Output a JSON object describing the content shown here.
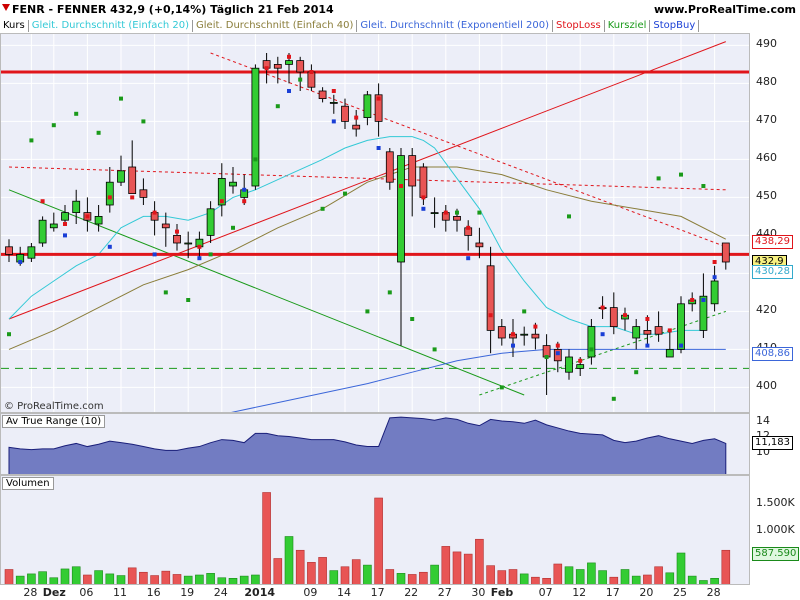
{
  "header": {
    "title": "FENR - FENNER   432,9 (+0,14%)   Täglich  21 Feb 2014",
    "site": "www.ProRealTime.com"
  },
  "legend": {
    "items": [
      {
        "label": "Kurs",
        "color": "#000000"
      },
      {
        "label": "Gleit. Durchschnitt (Einfach 20)",
        "color": "#33c9d6"
      },
      {
        "label": "Gleit. Durchschnitt (Einfach 40)",
        "color": "#8a7d3a"
      },
      {
        "label": "Gleit. Durchschnitt (Exponentiell 200)",
        "color": "#3b66d9"
      },
      {
        "label": "StopLoss",
        "color": "#e0151b"
      },
      {
        "label": "Kursziel",
        "color": "#1a9a1a"
      },
      {
        "label": "StopBuy",
        "color": "#1a3fd6"
      }
    ]
  },
  "copyright": "© ProRealTime.com",
  "atr_title": "Av True Range (10)",
  "volume_title": "Volumen",
  "colors": {
    "up": "#33cc33",
    "down": "#e85555",
    "price_pane_bg": "#eceef8",
    "atr_fill": "#4a55b0"
  },
  "chart_data": [
    {
      "type": "candlestick",
      "title": "FENR - FENNER",
      "ylim": [
        393,
        493
      ],
      "y_ticks": [
        400,
        410,
        420,
        430,
        440,
        450,
        460,
        470,
        480,
        490
      ],
      "x_tick_labels": [
        {
          "label": "28",
          "idx": 2
        },
        {
          "label": "Dez",
          "idx": 4,
          "bold": true
        },
        {
          "label": "06",
          "idx": 7
        },
        {
          "label": "11",
          "idx": 10
        },
        {
          "label": "16",
          "idx": 13
        },
        {
          "label": "19",
          "idx": 16
        },
        {
          "label": "24",
          "idx": 19
        },
        {
          "label": "2014",
          "idx": 22,
          "bold": true
        },
        {
          "label": "09",
          "idx": 27
        },
        {
          "label": "14",
          "idx": 30
        },
        {
          "label": "17",
          "idx": 33
        },
        {
          "label": "22",
          "idx": 36
        },
        {
          "label": "27",
          "idx": 39
        },
        {
          "label": "30",
          "idx": 42
        },
        {
          "label": "Feb",
          "idx": 44,
          "bold": true
        },
        {
          "label": "07",
          "idx": 48
        },
        {
          "label": "12",
          "idx": 51
        },
        {
          "label": "17",
          "idx": 54
        },
        {
          "label": "20",
          "idx": 57
        },
        {
          "label": "25",
          "idx": 60
        },
        {
          "label": "28",
          "idx": 63
        }
      ],
      "candles": [
        [
          437,
          439,
          433,
          435
        ],
        [
          433,
          437,
          432,
          435
        ],
        [
          434,
          438,
          433,
          437
        ],
        [
          438,
          445,
          437,
          444
        ],
        [
          442,
          446,
          441,
          443
        ],
        [
          444,
          448,
          443,
          446
        ],
        [
          446,
          452,
          443,
          449
        ],
        [
          446,
          450,
          441,
          444
        ],
        [
          443,
          448,
          441,
          445
        ],
        [
          448,
          458,
          446,
          454
        ],
        [
          454,
          461,
          453,
          457
        ],
        [
          458,
          465,
          453,
          451
        ],
        [
          452,
          455,
          448,
          450
        ],
        [
          446,
          449,
          440,
          444
        ],
        [
          443,
          446,
          437,
          442
        ],
        [
          440,
          443,
          436,
          438
        ],
        [
          438,
          441,
          434,
          438
        ],
        [
          437,
          441,
          434,
          439
        ],
        [
          440,
          449,
          438,
          447
        ],
        [
          448,
          459,
          445,
          455
        ],
        [
          453,
          458,
          451,
          454
        ],
        [
          450,
          456,
          448,
          452
        ],
        [
          453,
          485,
          452,
          484
        ],
        [
          486,
          488,
          480,
          484
        ],
        [
          485,
          487,
          480,
          484
        ],
        [
          485,
          488,
          480,
          486
        ],
        [
          486,
          487,
          478,
          483
        ],
        [
          483,
          485,
          478,
          479
        ],
        [
          478,
          479,
          475,
          476
        ],
        [
          475,
          477,
          472,
          475
        ],
        [
          474,
          476,
          468,
          470
        ],
        [
          469,
          473,
          466,
          468
        ],
        [
          471,
          478,
          469,
          477
        ],
        [
          477,
          480,
          466,
          470
        ],
        [
          462,
          463,
          452,
          454
        ],
        [
          433,
          463,
          411,
          461
        ],
        [
          461,
          463,
          445,
          453
        ],
        [
          458,
          459,
          448,
          450
        ],
        [
          446,
          450,
          442,
          446
        ],
        [
          446,
          448,
          441,
          444
        ],
        [
          445,
          447,
          441,
          444
        ],
        [
          442,
          444,
          436,
          440
        ],
        [
          438,
          442,
          434,
          437
        ],
        [
          432,
          437,
          409,
          415
        ],
        [
          416,
          418,
          411,
          413
        ],
        [
          414,
          418,
          408,
          413
        ],
        [
          414,
          416,
          411,
          414
        ],
        [
          414,
          417,
          410,
          413
        ],
        [
          411,
          414,
          398,
          408
        ],
        [
          410,
          412,
          404,
          407
        ],
        [
          404,
          410,
          402,
          408
        ],
        [
          405,
          408,
          403,
          406
        ],
        [
          408,
          418,
          406,
          416
        ],
        [
          421,
          424,
          418,
          421
        ],
        [
          421,
          425,
          414,
          416
        ],
        [
          418,
          421,
          415,
          419
        ],
        [
          413,
          418,
          410,
          416
        ],
        [
          415,
          419,
          411,
          414
        ],
        [
          416,
          420,
          412,
          414
        ],
        [
          408,
          415,
          408,
          410
        ],
        [
          410,
          424,
          409,
          422
        ],
        [
          422,
          425,
          420,
          423
        ],
        [
          415,
          430,
          413,
          424
        ],
        [
          422,
          432,
          420,
          428
        ],
        [
          438,
          438,
          431,
          433
        ]
      ],
      "sma20": [
        [
          0,
          418
        ],
        [
          2,
          424
        ],
        [
          4,
          428
        ],
        [
          6,
          432
        ],
        [
          8,
          435
        ],
        [
          10,
          442
        ],
        [
          12,
          445
        ],
        [
          14,
          445
        ],
        [
          16,
          444
        ],
        [
          18,
          446
        ],
        [
          20,
          450
        ],
        [
          22,
          452
        ],
        [
          25,
          456
        ],
        [
          28,
          460
        ],
        [
          30,
          463
        ],
        [
          32,
          465
        ],
        [
          34,
          466
        ],
        [
          35,
          466
        ],
        [
          36,
          466
        ],
        [
          37,
          465
        ],
        [
          38,
          463
        ],
        [
          40,
          455
        ],
        [
          42,
          447
        ],
        [
          44,
          436
        ],
        [
          46,
          428
        ],
        [
          48,
          421
        ],
        [
          50,
          418
        ],
        [
          52,
          416
        ],
        [
          54,
          416
        ],
        [
          56,
          414
        ],
        [
          58,
          414
        ],
        [
          60,
          415
        ],
        [
          62,
          415
        ]
      ],
      "sma40": [
        [
          0,
          410
        ],
        [
          4,
          415
        ],
        [
          8,
          421
        ],
        [
          12,
          427
        ],
        [
          16,
          431
        ],
        [
          20,
          436
        ],
        [
          24,
          442
        ],
        [
          28,
          447
        ],
        [
          32,
          454
        ],
        [
          36,
          458
        ],
        [
          40,
          458
        ],
        [
          44,
          456
        ],
        [
          48,
          452
        ],
        [
          52,
          449
        ],
        [
          56,
          447
        ],
        [
          60,
          445
        ],
        [
          64,
          439
        ]
      ],
      "ema200": [
        [
          0,
          384
        ],
        [
          8,
          386
        ],
        [
          16,
          391
        ],
        [
          24,
          396
        ],
        [
          32,
          401
        ],
        [
          36,
          404
        ],
        [
          40,
          407
        ],
        [
          44,
          409
        ],
        [
          48,
          410
        ],
        [
          52,
          410
        ],
        [
          56,
          410
        ],
        [
          60,
          410
        ],
        [
          64,
          410
        ]
      ],
      "hlines": [
        {
          "y": 483,
          "color": "#e0151b"
        },
        {
          "y": 435,
          "color": "#e0151b"
        },
        {
          "y": 405,
          "color": "#1a9a1a",
          "dashed": true
        }
      ],
      "trend_lines": [
        {
          "x1": 0,
          "y1": 418,
          "x2": 64,
          "y2": 491,
          "color": "#e0151b",
          "dashed": false
        },
        {
          "x1": 0,
          "y1": 458,
          "x2": 64,
          "y2": 452,
          "color": "#e0151b",
          "dashed": true
        },
        {
          "x1": 18,
          "y1": 488,
          "x2": 64,
          "y2": 437,
          "color": "#e0151b",
          "dashed": true
        },
        {
          "x1": 0,
          "y1": 452,
          "x2": 46,
          "y2": 398,
          "color": "#1a9a1a",
          "dashed": false
        },
        {
          "x1": 42,
          "y1": 398,
          "x2": 64,
          "y2": 420,
          "color": "#1a9a1a",
          "dashed": true
        }
      ],
      "stoploss_dots": [
        [
          3,
          449
        ],
        [
          5,
          443
        ],
        [
          7,
          445
        ],
        [
          9,
          450
        ],
        [
          11,
          450
        ],
        [
          13,
          446
        ],
        [
          15,
          441
        ],
        [
          17,
          437
        ],
        [
          19,
          449
        ],
        [
          21,
          449
        ],
        [
          23,
          484
        ],
        [
          25,
          487
        ],
        [
          27,
          483
        ],
        [
          29,
          478
        ],
        [
          31,
          471
        ],
        [
          33,
          476
        ],
        [
          35,
          453
        ],
        [
          37,
          450
        ],
        [
          39,
          446
        ],
        [
          41,
          442
        ],
        [
          43,
          419
        ],
        [
          45,
          414
        ],
        [
          47,
          416
        ],
        [
          49,
          411
        ],
        [
          51,
          407
        ],
        [
          53,
          421
        ],
        [
          55,
          419
        ],
        [
          57,
          418
        ],
        [
          59,
          415
        ],
        [
          61,
          423
        ],
        [
          63,
          433
        ]
      ],
      "kursziel_dots": [
        [
          0,
          414
        ],
        [
          2,
          465
        ],
        [
          4,
          469
        ],
        [
          6,
          472
        ],
        [
          8,
          467
        ],
        [
          10,
          476
        ],
        [
          12,
          470
        ],
        [
          14,
          425
        ],
        [
          16,
          423
        ],
        [
          18,
          435
        ],
        [
          20,
          442
        ],
        [
          22,
          460
        ],
        [
          24,
          474
        ],
        [
          26,
          481
        ],
        [
          28,
          447
        ],
        [
          30,
          451
        ],
        [
          32,
          420
        ],
        [
          34,
          425
        ],
        [
          36,
          418
        ],
        [
          38,
          410
        ],
        [
          40,
          446
        ],
        [
          42,
          446
        ],
        [
          44,
          400
        ],
        [
          46,
          420
        ],
        [
          48,
          408
        ],
        [
          50,
          445
        ],
        [
          52,
          410
        ],
        [
          54,
          397
        ],
        [
          56,
          404
        ],
        [
          58,
          455
        ],
        [
          60,
          456
        ],
        [
          62,
          453
        ]
      ],
      "stopbuy_dots": [
        [
          1,
          433
        ],
        [
          5,
          440
        ],
        [
          9,
          437
        ],
        [
          13,
          435
        ],
        [
          17,
          434
        ],
        [
          21,
          452
        ],
        [
          25,
          478
        ],
        [
          29,
          470
        ],
        [
          33,
          463
        ],
        [
          37,
          447
        ],
        [
          41,
          434
        ],
        [
          45,
          411
        ],
        [
          49,
          409
        ],
        [
          53,
          414
        ],
        [
          57,
          411
        ],
        [
          60,
          411
        ],
        [
          62,
          423
        ],
        [
          63,
          429
        ]
      ],
      "price_boxes": [
        {
          "y": 438.29,
          "text": "438,29",
          "color": "#e0151b"
        },
        {
          "y": 432.9,
          "text": "432,9",
          "color": "#000000",
          "bg": "#f6f080"
        },
        {
          "y": 430.28,
          "text": "430,28",
          "color": "#33aacc"
        },
        {
          "y": 408.86,
          "text": "408,86",
          "color": "#3b66d9"
        }
      ]
    },
    {
      "type": "area",
      "title": "Av True Range (10)",
      "ylim": [
        7,
        15
      ],
      "y_ticks": [
        10,
        12,
        14
      ],
      "last_value": "11,183",
      "values": [
        10.7,
        10.5,
        10.4,
        10.5,
        10.5,
        10.9,
        11.2,
        10.8,
        11.1,
        11.5,
        11.3,
        11.1,
        10.8,
        10.5,
        10.3,
        10.3,
        10.6,
        10.8,
        11.3,
        11.7,
        11.6,
        11.3,
        12.5,
        12.5,
        12.2,
        12.1,
        11.9,
        11.7,
        11.7,
        11.7,
        11.4,
        11.0,
        10.8,
        10.8,
        14.5,
        14.6,
        14.5,
        14.4,
        14.2,
        14.5,
        14.3,
        13.8,
        13.5,
        14.3,
        14.1,
        14.0,
        13.8,
        14.2,
        13.6,
        13.2,
        12.8,
        12.5,
        12.4,
        12.3,
        11.6,
        11.3,
        11.5,
        11.9,
        12.2,
        11.8,
        11.5,
        11.2,
        11.6,
        11.8,
        11.2
      ]
    },
    {
      "type": "bar",
      "title": "Volumen",
      "ylim": [
        0,
        2000000
      ],
      "y_ticks": [
        {
          "value": 1500000,
          "label": "1.500K"
        },
        {
          "value": 1000000,
          "label": "1.000K"
        },
        {
          "value": 500000,
          "label": "500K"
        }
      ],
      "last_value": "587.590",
      "values": [
        300000,
        180000,
        220000,
        260000,
        150000,
        310000,
        350000,
        200000,
        280000,
        220000,
        190000,
        330000,
        250000,
        190000,
        270000,
        210000,
        180000,
        200000,
        230000,
        150000,
        140000,
        180000,
        200000,
        1700000,
        500000,
        900000,
        650000,
        430000,
        520000,
        280000,
        350000,
        480000,
        380000,
        1600000,
        300000,
        230000,
        210000,
        250000,
        380000,
        720000,
        620000,
        580000,
        850000,
        370000,
        280000,
        300000,
        220000,
        160000,
        140000,
        400000,
        350000,
        300000,
        420000,
        280000,
        160000,
        300000,
        180000,
        200000,
        350000,
        240000,
        600000,
        180000,
        100000,
        140000,
        650000
      ]
    }
  ]
}
